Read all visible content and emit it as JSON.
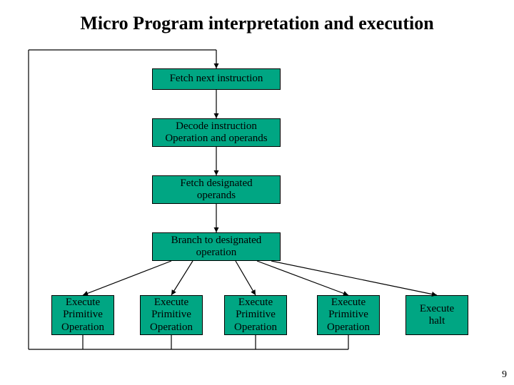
{
  "title": "Micro Program interpretation and execution",
  "boxes": {
    "fetch_next": "Fetch next instruction",
    "decode": "Decode instruction\nOperation and operands",
    "fetch_operands": "Fetch designated\noperands",
    "branch": "Branch to designated\noperation",
    "exec1": "Execute\nPrimitive\nOperation",
    "exec2": "Execute\nPrimitive\nOperation",
    "exec3": "Execute\nPrimitive\nOperation",
    "exec4": "Execute\nPrimitive\nOperation",
    "halt": "Execute\nhalt"
  },
  "page_number": "9",
  "colors": {
    "box_fill": "#00a683",
    "line": "#000000"
  }
}
